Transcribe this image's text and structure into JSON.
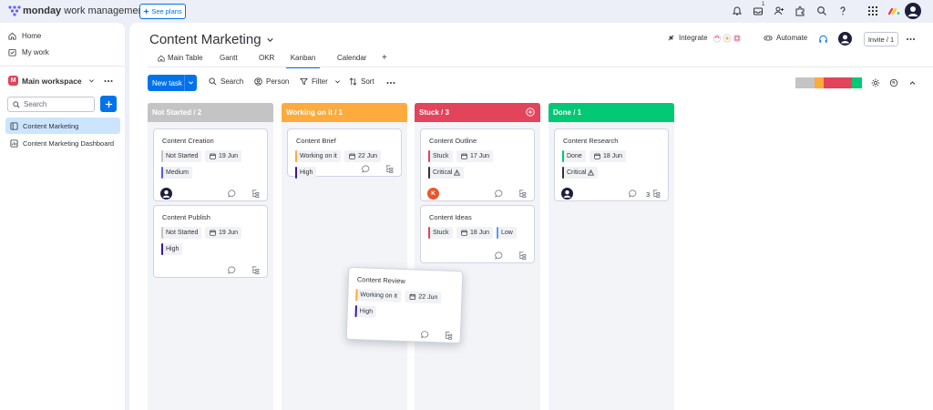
{
  "app": {
    "logo_brand": "monday",
    "logo_product": "work management",
    "see_plans": "See plans",
    "inbox_badge": "1"
  },
  "sidebar": {
    "nav": [
      {
        "label": "Home",
        "icon": "home-icon"
      },
      {
        "label": "My work",
        "icon": "my-work-icon"
      }
    ],
    "workspace": {
      "badge": "M",
      "label": "Main workspace"
    },
    "search_placeholder": "Search",
    "boards": [
      {
        "label": "Content Marketing",
        "icon": "board-icon",
        "active": true
      },
      {
        "label": "Content Marketing Dashboard",
        "icon": "dashboard-icon",
        "active": false
      }
    ]
  },
  "board": {
    "title": "Content Marketing",
    "tabs": [
      {
        "label": "Main Table",
        "active": false
      },
      {
        "label": "Gantt",
        "active": false
      },
      {
        "label": "OKR",
        "active": false
      },
      {
        "label": "Kanban",
        "active": true
      },
      {
        "label": "Calendar",
        "active": false
      },
      {
        "label": "+",
        "active": false
      }
    ],
    "integrate": "Integrate",
    "automate": "Automate",
    "invite": "Invite / 1"
  },
  "toolbar": {
    "new_task": "New task",
    "search": "Search",
    "person": "Person",
    "filter": "Filter",
    "sort": "Sort",
    "colors": [
      "#c4c4c4",
      "#fdab3d",
      "#e2445c",
      "#00c875"
    ]
  },
  "columns": [
    {
      "header": "Not Started / 2",
      "color": "#c4c4c4",
      "cards": [
        {
          "title": "Content Creation",
          "status": "Not Started",
          "status_color": "#c4c4c4",
          "date": "19 Jun",
          "priority": "Medium",
          "priority_color": "#5559df",
          "person": "avatar"
        },
        {
          "title": "Content Publish",
          "status": "Not Started",
          "status_color": "#c4c4c4",
          "date": "19 Jun",
          "priority": "High",
          "priority_color": "#401694"
        }
      ]
    },
    {
      "header": "Working on it / 1",
      "color": "#fdab3d",
      "cards": [
        {
          "title": "Content Brief",
          "status": "Working on it",
          "status_color": "#fdab3d",
          "date": "22 Jun",
          "priority": "High",
          "priority_color": "#401694"
        }
      ]
    },
    {
      "header": "Stuck / 3",
      "color": "#e2445c",
      "cards": [
        {
          "title": "Content Outline",
          "status": "Stuck",
          "status_color": "#e2445c",
          "date": "17 Jun",
          "priority": "Critical",
          "priority_color": "#333333",
          "person": "K"
        },
        {
          "title": "Content Ideas",
          "status": "Stuck",
          "status_color": "#e2445c",
          "date": "18 Jun",
          "priority": "Low",
          "priority_color": "#579bfc"
        }
      ]
    },
    {
      "header": "Done / 1",
      "color": "#00c875",
      "cards": [
        {
          "title": "Content Research",
          "status": "Done",
          "status_color": "#00c875",
          "date": "18 Jun",
          "priority": "Critical",
          "priority_color": "#333333",
          "person": "avatar",
          "subitems": "3"
        }
      ]
    }
  ],
  "dragging_card": {
    "title": "Content Review",
    "status": "Working on it",
    "status_color": "#fdab3d",
    "date": "22 Jun",
    "priority": "High",
    "priority_color": "#401694"
  }
}
